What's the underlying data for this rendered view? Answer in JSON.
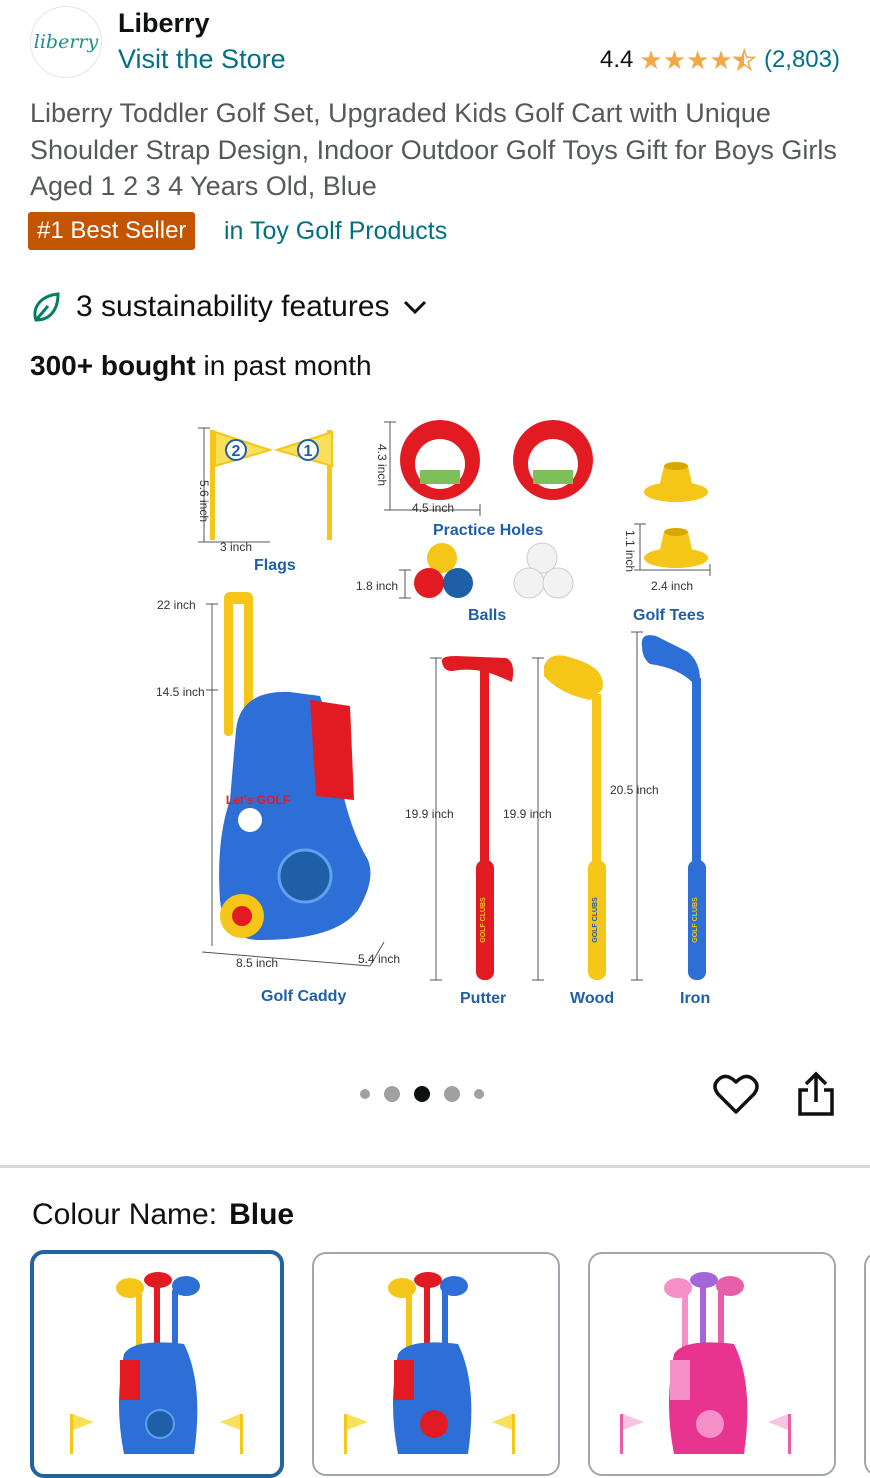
{
  "header": {
    "brand_logo_text": "liberry",
    "brand_name": "Liberry",
    "store_link": "Visit the Store",
    "rating_value": "4.4",
    "rating_stars": 4.4,
    "rating_count": "(2,803)"
  },
  "product": {
    "title": "Liberry Toddler Golf Set, Upgraded Kids Golf Cart with Unique Shoulder Strap Design, Indoor Outdoor Golf Toys Gift for Boys Girls Aged 1 2 3 4 Years Old, Blue",
    "badge": "#1 Best Seller",
    "badge_category": "in Toy Golf Products",
    "sustainability": "3 sustainability features",
    "bought_bold": "300+ bought",
    "bought_rest": " in past month"
  },
  "image": {
    "labels": {
      "flags": "Flags",
      "practice_holes": "Practice Holes",
      "balls": "Balls",
      "golf_tees": "Golf Tees",
      "golf_caddy": "Golf Caddy",
      "putter": "Putter",
      "wood": "Wood",
      "iron": "Iron"
    },
    "dims": {
      "flag_height": "5.6 inch",
      "flag_width": "3 inch",
      "hole_height": "4.3 inch",
      "hole_width": "4.5 inch",
      "tee_height": "1.1 inch",
      "tee_width": "2.4 inch",
      "ball": "1.8 inch",
      "caddy_tall": "22 inch",
      "caddy_short": "14.5 inch",
      "caddy_depth": "8.5 inch",
      "caddy_width": "5.4 inch",
      "putter_len": "19.9 inch",
      "wood_len": "19.9 inch",
      "iron_len": "20.5 inch"
    },
    "shaft_text": "GOLF CLUBS",
    "caddy_text": "Let's GOLF",
    "flag_numbers": [
      "2",
      "1"
    ]
  },
  "carousel": {
    "count": 5,
    "active_index": 2
  },
  "colour": {
    "label": "Colour Name:",
    "value": "Blue",
    "swatches": [
      "Blue",
      "Blue",
      "Pink"
    ]
  },
  "colors": {
    "link": "#007185",
    "badge": "#c45500",
    "star": "#f3a847",
    "selected_border": "#2162a1"
  }
}
